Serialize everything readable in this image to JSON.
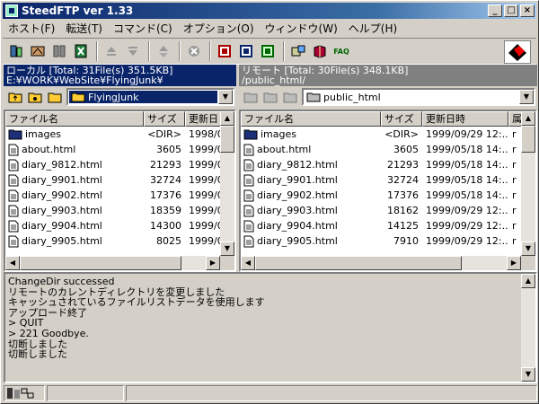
{
  "window": {
    "title": "SteedFTP ver 1.33"
  },
  "menu": [
    "ホスト(F)",
    "転送(T)",
    "コマンド(C)",
    "オプション(O)",
    "ウィンドウ(W)",
    "ヘルプ(H)"
  ],
  "toolbar": {
    "faq_label": "FAQ"
  },
  "left": {
    "summary": "ローカル [Total: 31File(s) 351.5KB]",
    "path": "E:¥WORK¥WebSite¥FlyingJunk¥",
    "folder": "FlyingJunk",
    "columns": [
      "ファイル名",
      "サイズ",
      "更新日"
    ],
    "rows": [
      {
        "name": "images",
        "size": "<DIR>",
        "date": "1998/0",
        "type": "folder"
      },
      {
        "name": "about.html",
        "size": "3605",
        "date": "1999/0",
        "type": "file"
      },
      {
        "name": "diary_9812.html",
        "size": "21293",
        "date": "1999/0",
        "type": "file"
      },
      {
        "name": "diary_9901.html",
        "size": "32724",
        "date": "1999/0",
        "type": "file"
      },
      {
        "name": "diary_9902.html",
        "size": "17376",
        "date": "1999/0",
        "type": "file"
      },
      {
        "name": "diary_9903.html",
        "size": "18359",
        "date": "1999/0",
        "type": "file"
      },
      {
        "name": "diary_9904.html",
        "size": "14300",
        "date": "1999/0",
        "type": "file"
      },
      {
        "name": "diary_9905.html",
        "size": "8025",
        "date": "1999/0",
        "type": "file"
      }
    ]
  },
  "right": {
    "summary": "リモート [Total: 30File(s) 348.1KB]",
    "path": "/public_html/",
    "folder": "public_html",
    "columns": [
      "ファイル名",
      "サイズ",
      "更新日時",
      "属"
    ],
    "rows": [
      {
        "name": "images",
        "size": "<DIR>",
        "date": "1999/09/29 12:...",
        "attr": "r",
        "type": "folder"
      },
      {
        "name": "about.html",
        "size": "3605",
        "date": "1999/05/18 14:...",
        "attr": "r",
        "type": "file"
      },
      {
        "name": "diary_9812.html",
        "size": "21293",
        "date": "1999/05/18 14:...",
        "attr": "r",
        "type": "file"
      },
      {
        "name": "diary_9901.html",
        "size": "32724",
        "date": "1999/05/18 14:...",
        "attr": "r",
        "type": "file"
      },
      {
        "name": "diary_9902.html",
        "size": "17376",
        "date": "1999/05/18 14:...",
        "attr": "r",
        "type": "file"
      },
      {
        "name": "diary_9903.html",
        "size": "18162",
        "date": "1999/09/29 12:...",
        "attr": "r",
        "type": "file"
      },
      {
        "name": "diary_9904.html",
        "size": "14125",
        "date": "1999/09/29 12:...",
        "attr": "r",
        "type": "file"
      },
      {
        "name": "diary_9905.html",
        "size": "7910",
        "date": "1999/09/29 12:...",
        "attr": "r",
        "type": "file"
      }
    ]
  },
  "log": [
    "ChangeDir successed",
    "リモートのカレントディレクトリを変更しました",
    "キャッシュされているファイルリストデータを使用します",
    "アップロード終了",
    "> QUIT",
    "> 221 Goodbye.",
    "切断しました",
    "切断しました"
  ]
}
